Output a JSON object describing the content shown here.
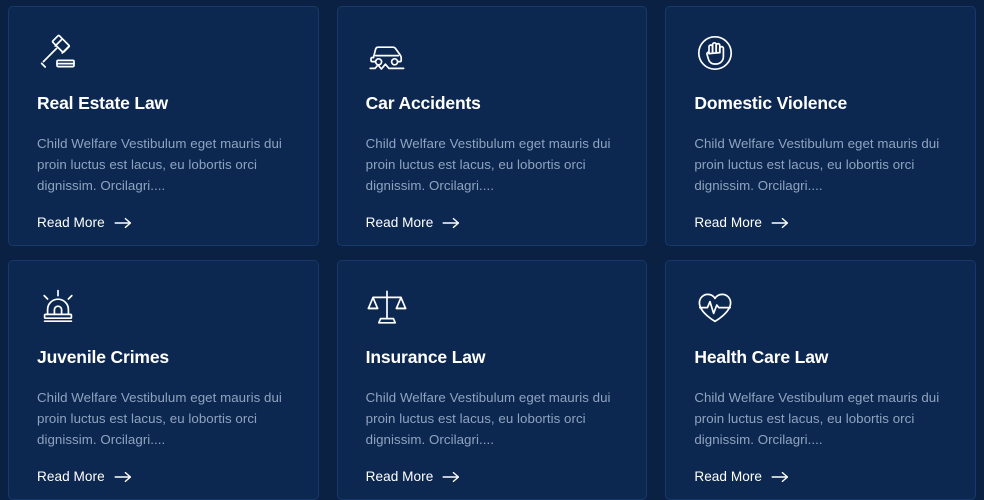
{
  "theme": {
    "page_background": "#0a2144",
    "card_background": "#0d2850",
    "card_border": "#17386b",
    "title_color": "#ffffff",
    "body_color": "#8fa3bf",
    "link_color": "#ffffff",
    "icon_color": "#ffffff"
  },
  "grid": {
    "columns": 3,
    "rows": 2,
    "cards": [
      {
        "icon": "gavel-icon",
        "title": "Real Estate Law",
        "description": "Child Welfare Vestibulum eget mauris dui proin luctus est lacus, eu lobortis orci dignissim. Orcilagri....",
        "link_label": "Read More",
        "link_arrow": "arrow-right-icon"
      },
      {
        "icon": "car-accident-icon",
        "title": "Car Accidents",
        "description": "Child Welfare Vestibulum eget mauris dui proin luctus est lacus, eu lobortis orci dignissim. Orcilagri....",
        "link_label": "Read More",
        "link_arrow": "arrow-right-icon"
      },
      {
        "icon": "stop-hand-icon",
        "title": "Domestic Violence",
        "description": "Child Welfare Vestibulum eget mauris dui proin luctus est lacus, eu lobortis orci dignissim. Orcilagri....",
        "link_label": "Read More",
        "link_arrow": "arrow-right-icon"
      },
      {
        "icon": "police-siren-icon",
        "title": "Juvenile Crimes",
        "description": "Child Welfare Vestibulum eget mauris dui proin luctus est lacus, eu lobortis orci dignissim. Orcilagri....",
        "link_label": "Read More",
        "link_arrow": "arrow-right-icon"
      },
      {
        "icon": "scales-of-justice-icon",
        "title": "Insurance Law",
        "description": "Child Welfare Vestibulum eget mauris dui proin luctus est lacus, eu lobortis orci dignissim. Orcilagri....",
        "link_label": "Read More",
        "link_arrow": "arrow-right-icon"
      },
      {
        "icon": "heart-pulse-icon",
        "title": "Health Care Law",
        "description": "Child Welfare Vestibulum eget mauris dui proin luctus est lacus, eu lobortis orci dignissim. Orcilagri....",
        "link_label": "Read More",
        "link_arrow": "arrow-right-icon"
      }
    ]
  }
}
